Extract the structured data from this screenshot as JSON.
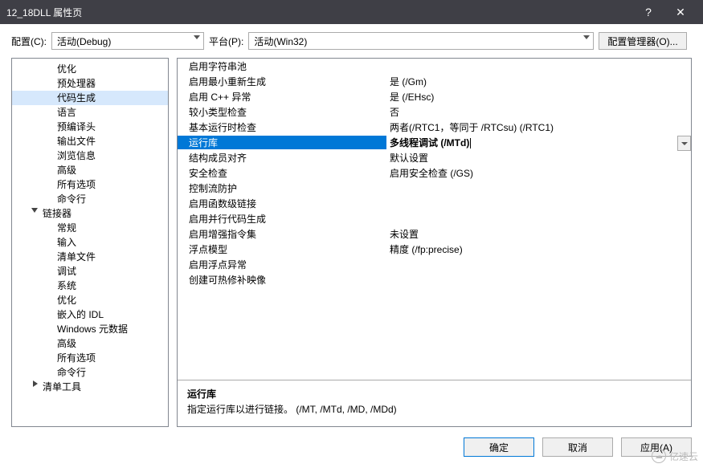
{
  "window": {
    "title": "12_18DLL 属性页",
    "help": "?",
    "close": "✕"
  },
  "topbar": {
    "config_label": "配置(C):",
    "config_value": "活动(Debug)",
    "platform_label": "平台(P):",
    "platform_value": "活动(Win32)",
    "manager_btn": "配置管理器(O)..."
  },
  "tree": [
    {
      "label": "优化",
      "type": "item"
    },
    {
      "label": "预处理器",
      "type": "item"
    },
    {
      "label": "代码生成",
      "type": "item",
      "selected": true
    },
    {
      "label": "语言",
      "type": "item"
    },
    {
      "label": "预编译头",
      "type": "item"
    },
    {
      "label": "输出文件",
      "type": "item"
    },
    {
      "label": "浏览信息",
      "type": "item"
    },
    {
      "label": "高级",
      "type": "item"
    },
    {
      "label": "所有选项",
      "type": "item"
    },
    {
      "label": "命令行",
      "type": "item"
    },
    {
      "label": "链接器",
      "type": "group",
      "expanded": true
    },
    {
      "label": "常规",
      "type": "item"
    },
    {
      "label": "输入",
      "type": "item"
    },
    {
      "label": "清单文件",
      "type": "item"
    },
    {
      "label": "调试",
      "type": "item"
    },
    {
      "label": "系统",
      "type": "item"
    },
    {
      "label": "优化",
      "type": "item"
    },
    {
      "label": "嵌入的 IDL",
      "type": "item"
    },
    {
      "label": "Windows 元数据",
      "type": "item"
    },
    {
      "label": "高级",
      "type": "item"
    },
    {
      "label": "所有选项",
      "type": "item"
    },
    {
      "label": "命令行",
      "type": "item"
    },
    {
      "label": "清单工具",
      "type": "group",
      "expanded": false
    }
  ],
  "grid": [
    {
      "k": "启用字符串池",
      "v": ""
    },
    {
      "k": "启用最小重新生成",
      "v": "是 (/Gm)"
    },
    {
      "k": "启用 C++ 异常",
      "v": "是 (/EHsc)"
    },
    {
      "k": "较小类型检查",
      "v": "否"
    },
    {
      "k": "基本运行时检查",
      "v": "两者(/RTC1，等同于 /RTCsu) (/RTC1)"
    },
    {
      "k": "运行库",
      "v": "多线程调试 (/MTd)",
      "selected": true
    },
    {
      "k": "结构成员对齐",
      "v": "默认设置"
    },
    {
      "k": "安全检查",
      "v": "启用安全检查 (/GS)"
    },
    {
      "k": "控制流防护",
      "v": ""
    },
    {
      "k": "启用函数级链接",
      "v": ""
    },
    {
      "k": "启用并行代码生成",
      "v": ""
    },
    {
      "k": "启用增强指令集",
      "v": "未设置"
    },
    {
      "k": "浮点模型",
      "v": "精度 (/fp:precise)"
    },
    {
      "k": "启用浮点异常",
      "v": ""
    },
    {
      "k": "创建可热修补映像",
      "v": ""
    }
  ],
  "description": {
    "title": "运行库",
    "body": "指定运行库以进行链接。     (/MT, /MTd, /MD, /MDd)"
  },
  "footer": {
    "ok": "确定",
    "cancel": "取消",
    "apply": "应用(A)"
  },
  "watermark": "亿速云"
}
